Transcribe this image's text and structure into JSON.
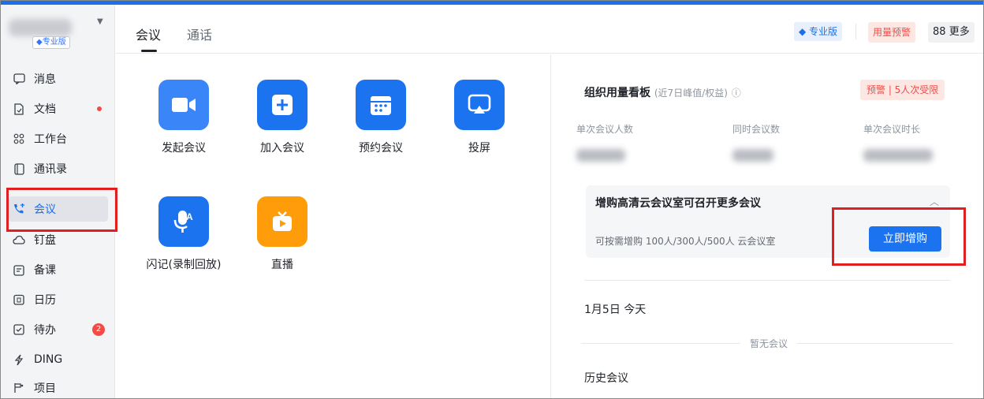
{
  "profile": {
    "plan_badge": "专业版"
  },
  "sidebar": {
    "items": [
      {
        "label": "消息",
        "icon": "chat-bubble-icon"
      },
      {
        "label": "文档",
        "icon": "document-icon",
        "dot": true
      },
      {
        "label": "工作台",
        "icon": "grid-icon"
      },
      {
        "label": "通讯录",
        "icon": "contacts-icon"
      },
      {
        "label": "会议",
        "icon": "phone-icon",
        "active": true
      },
      {
        "label": "钉盘",
        "icon": "cloud-drive-icon"
      },
      {
        "label": "备课",
        "icon": "lesson-icon"
      },
      {
        "label": "日历",
        "icon": "calendar-icon"
      },
      {
        "label": "待办",
        "icon": "todo-icon",
        "badge": "2"
      },
      {
        "label": "DING",
        "icon": "ding-icon"
      },
      {
        "label": "项目",
        "icon": "project-icon"
      }
    ]
  },
  "header": {
    "tabs": [
      "会议",
      "通话"
    ],
    "pro_badge": "专业版",
    "usage_warning": "用量预警",
    "more": "更多"
  },
  "apps": [
    {
      "label": "发起会议",
      "icon": "video-camera-icon"
    },
    {
      "label": "加入会议",
      "icon": "plus-icon"
    },
    {
      "label": "预约会议",
      "icon": "calendar-schedule-icon"
    },
    {
      "label": "投屏",
      "icon": "screen-cast-icon"
    },
    {
      "label": "闪记(录制回放)",
      "icon": "voice-record-icon"
    },
    {
      "label": "直播",
      "icon": "live-tv-icon"
    }
  ],
  "board": {
    "title": "组织用量看板",
    "subtitle": "(近7日峰值/权益)",
    "alert": "预警 | 5人次受限",
    "metrics": [
      "单次会议人数",
      "同时会议数",
      "单次会议时长"
    ]
  },
  "promo": {
    "title": "增购高清云会议室可召开更多会议",
    "desc": "可按需增购 100人/300人/500人 云会议室",
    "button": "立即增购"
  },
  "schedule": {
    "date": "1月5日 今天",
    "empty": "暂无会议",
    "history": "历史会议"
  },
  "colors": {
    "accent": "#1b73f0",
    "warning": "#f54a45",
    "highlight": "#e02020"
  }
}
